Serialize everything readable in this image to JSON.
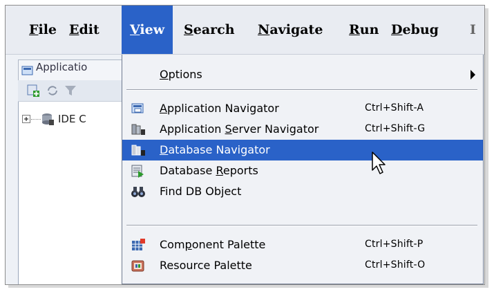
{
  "menubar": {
    "items": [
      {
        "pre": "",
        "m": "F",
        "post": "ile"
      },
      {
        "pre": "",
        "m": "E",
        "post": "dit"
      },
      {
        "pre": "",
        "m": "V",
        "post": "iew"
      },
      {
        "pre": "",
        "m": "S",
        "post": "earch"
      },
      {
        "pre": "",
        "m": "N",
        "post": "avigate"
      },
      {
        "pre": "",
        "m": "R",
        "post": "un"
      },
      {
        "pre": "",
        "m": "D",
        "post": "ebug"
      }
    ]
  },
  "ide": {
    "applications_tab_label": "Applicatio",
    "tree_node_label": "IDE C"
  },
  "view_menu": {
    "options": {
      "pre": "",
      "m": "O",
      "post": "ptions"
    },
    "items": [
      {
        "pre": "",
        "m": "A",
        "post": "pplication Navigator",
        "shortcut": "Ctrl+Shift-A",
        "icon": "application-navigator-icon"
      },
      {
        "pre": "Application ",
        "m": "S",
        "post": "erver Navigator",
        "shortcut": "Ctrl+Shift-G",
        "icon": "server-navigator-icon"
      },
      {
        "pre": "",
        "m": "D",
        "post": "atabase Navigator",
        "shortcut": "",
        "icon": "database-navigator-icon"
      },
      {
        "pre": "Database ",
        "m": "R",
        "post": "eports",
        "shortcut": "",
        "icon": "database-reports-icon"
      },
      {
        "pre": "Find DB Object",
        "m": "",
        "post": "",
        "shortcut": "",
        "icon": "binoculars-icon"
      },
      {
        "pre": "Com",
        "m": "p",
        "post": "onent Palette",
        "shortcut": "Ctrl+Shift-P",
        "icon": "component-palette-icon"
      },
      {
        "pre": "Resource Palette",
        "m": "",
        "post": "",
        "shortcut": "Ctrl+Shift-O",
        "icon": "resource-palette-icon"
      }
    ],
    "highlighted_index": 2
  },
  "colors": {
    "highlight": "#2a62c8",
    "menu_bg": "#f0f2f6"
  }
}
